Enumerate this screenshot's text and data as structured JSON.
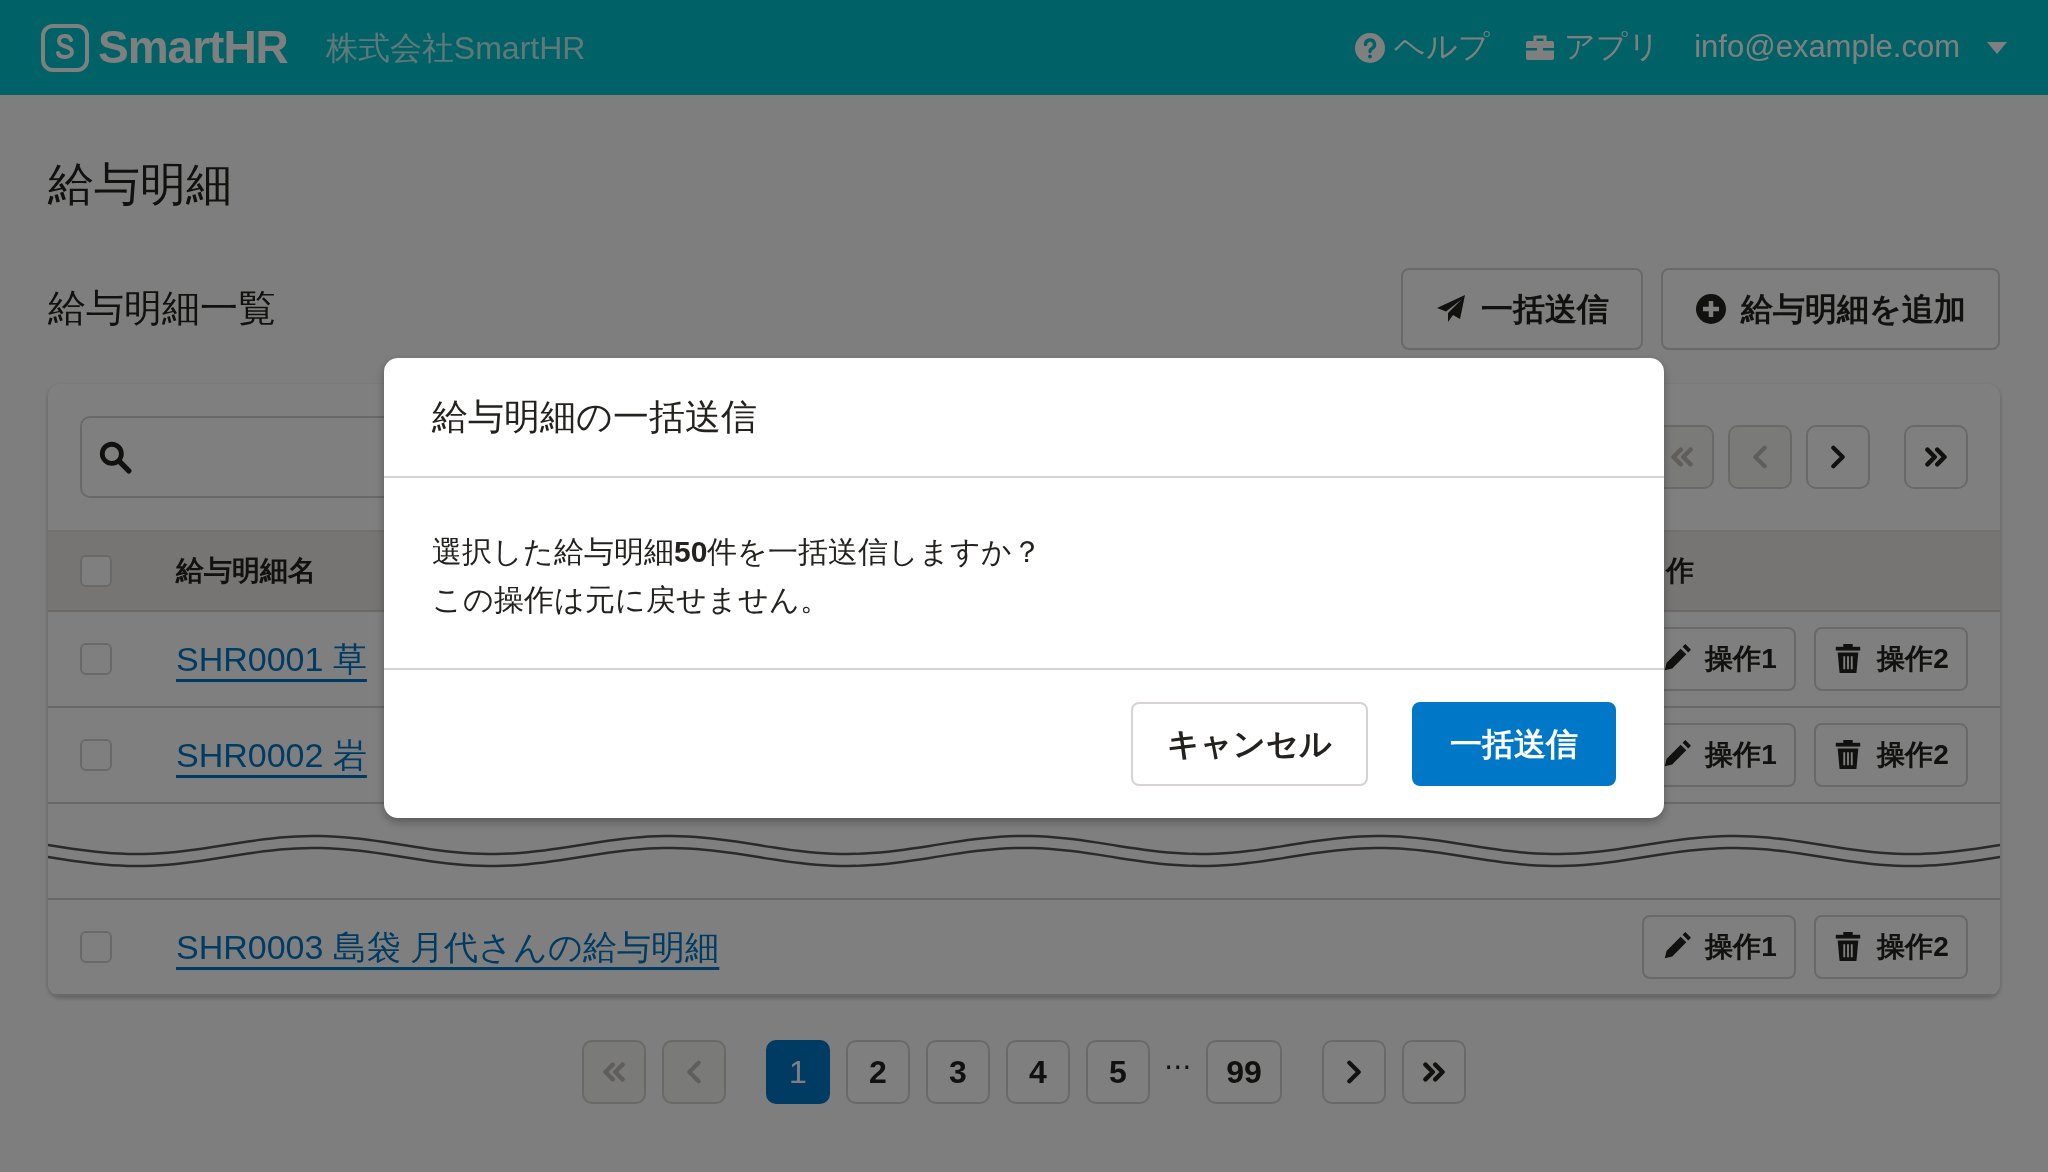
{
  "header": {
    "logo": "SmartHR",
    "company": "株式会社SmartHR",
    "links": [
      {
        "label": "ヘルプ",
        "kind": "help"
      },
      {
        "label": "アプリ",
        "kind": "apps"
      }
    ],
    "user_menu": "info@example.com"
  },
  "page_title": "給与明細",
  "section_title": "給与明細一覧",
  "actions": [
    {
      "label": "一括送信",
      "kind": "send"
    },
    {
      "label": "給与明細を追加",
      "kind": "add"
    }
  ],
  "top_pager": [
    {
      "kind": "first",
      "disabled": true
    },
    {
      "kind": "prev",
      "disabled": true
    },
    {
      "kind": "next",
      "disabled": false
    },
    {
      "kind": "last",
      "disabled": false
    }
  ],
  "table": {
    "header_checked": false,
    "columns": [
      "給与明細名",
      "作"
    ],
    "rows": [
      {
        "kind": "row",
        "checked": false,
        "name": "SHR0001 草",
        "actions": [
          "操作1",
          "操作2"
        ]
      },
      {
        "kind": "row",
        "checked": false,
        "name": "SHR0002 岩",
        "actions": [
          "操作1",
          "操作2"
        ]
      },
      {
        "kind": "break"
      },
      {
        "kind": "row",
        "checked": false,
        "name": "SHR0003 島袋 月代さんの給与明細",
        "actions": [
          "操作1",
          "操作2"
        ]
      }
    ]
  },
  "pagination": {
    "first_disabled": true,
    "prev_disabled": true,
    "pages": [
      {
        "label": "1",
        "selected": true
      },
      {
        "label": "2",
        "selected": false
      },
      {
        "label": "3",
        "selected": false
      },
      {
        "label": "4",
        "selected": false
      },
      {
        "label": "5",
        "selected": false
      },
      {
        "label": "⋯",
        "kind": "ellipsis"
      },
      {
        "label": "99",
        "selected": false
      }
    ],
    "next_disabled": false,
    "last_disabled": false
  },
  "modal": {
    "title": "給与明細の一括送信",
    "message": [
      "選択した給与明細**50**件を一括送信しますか？",
      "この操作は元に戻せません。"
    ],
    "buttons": [
      {
        "label": "キャンセル",
        "kind": "secondary"
      },
      {
        "label": "一括送信",
        "kind": "primary"
      }
    ]
  }
}
